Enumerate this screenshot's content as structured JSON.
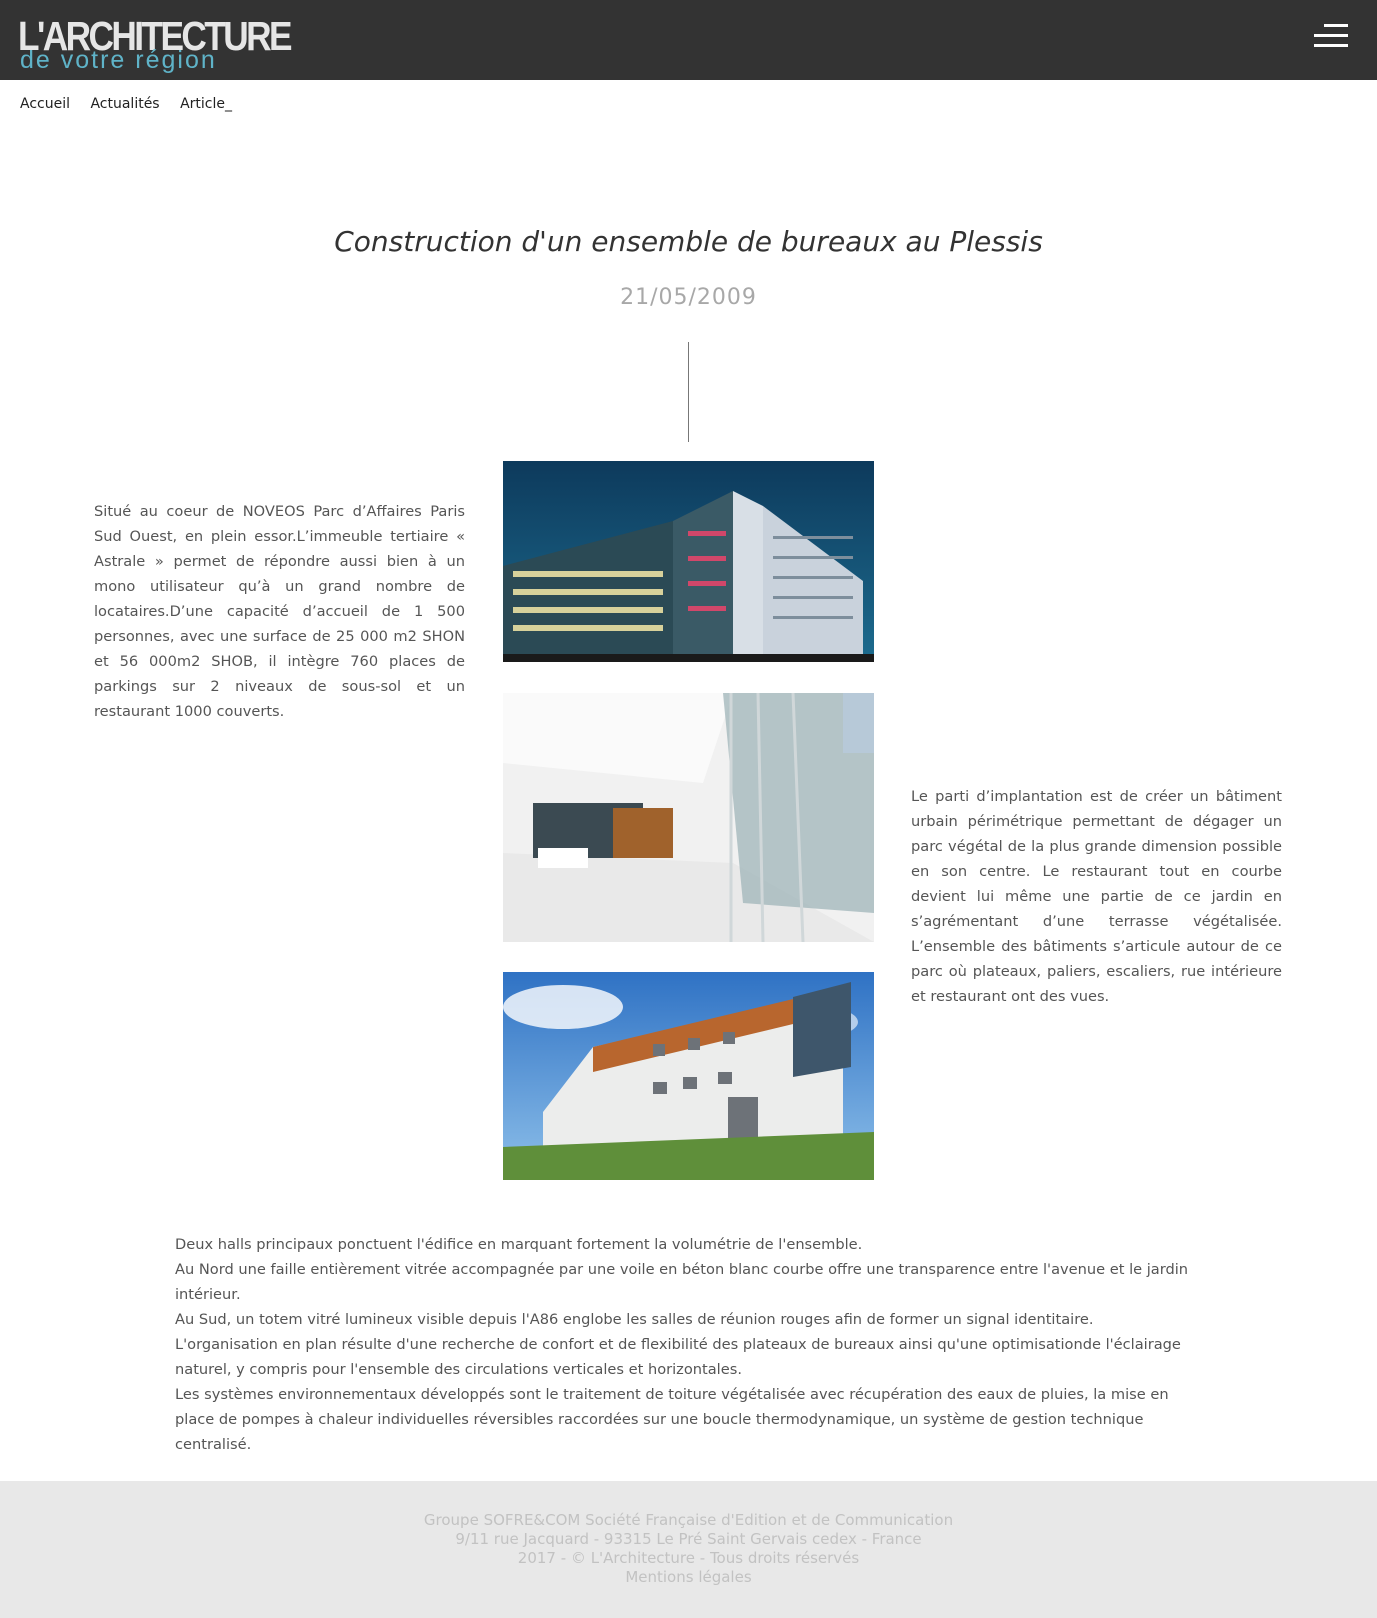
{
  "header": {
    "logo_main": "L'ARCHITECTURE",
    "logo_sub": "de votre région",
    "menu_icon": "hamburger-icon"
  },
  "breadcrumb": [
    "Accueil",
    "Actualités",
    "Article_"
  ],
  "article": {
    "title": "Construction d'un ensemble de bureaux au Plessis",
    "date": "21/05/2009",
    "left_text": "Situé au coeur de NOVEOS Parc d’Affaires Paris Sud Ouest, en plein essor.L’immeuble tertiaire « Astrale » permet de répondre aussi bien à un mono utilisateur qu’à un grand nombre de locataires.D’une capacité d’accueil de 1 500 personnes, avec une surface de 25 000 m2 SHON et 56 000m2 SHOB, il intègre 760 places de parkings sur 2 niveaux de sous-sol et un restaurant 1000 couverts.",
    "right_text": "Le parti d’implantation est de créer un bâtiment urbain périmétrique permettant de dégager un parc végétal de la plus grande dimension possible en son centre. Le restaurant tout en courbe devient lui même une partie de ce jardin en s’agrémentant d’une terrasse végétalisée. L’ensemble des bâtiments s’articule autour de ce parc où plateaux, paliers, escaliers, rue intérieure et restaurant ont des vues.",
    "paragraphs": [
      "Deux halls principaux ponctuent l'édifice en marquant fortement la volumétrie de l'ensemble.",
      "Au Nord une faille entièrement vitrée accompagnée par une voile en béton blanc courbe offre une transparence entre l'avenue et le jardin intérieur.",
      "Au Sud, un totem vitré lumineux visible depuis l'A86 englobe les salles de réunion rouges afin de former un signal identitaire.",
      "L'organisation en plan résulte d'une recherche de confort et de flexibilité des plateaux de bureaux ainsi qu'une optimisationde l'éclairage naturel, y compris pour l'ensemble des circulations verticales et horizontales.",
      "Les systèmes environnementaux développés sont le traitement de toiture végétalisée avec récupération des eaux de pluies, la mise en place de pompes à chaleur individuelles réversibles raccordées sur une boucle thermodynamique, un système de gestion technique centralisé."
    ]
  },
  "footer": {
    "line1": "Groupe SOFRE&COM Société Française d'Edition et de Communication",
    "line2": "9/11 rue Jacquard - 93315 Le Pré Saint Gervais cedex - France",
    "line3": "2017 - © L'Architecture - Tous droits réservés",
    "legal_link": "Mentions légales"
  },
  "colors": {
    "header_bg": "#333333",
    "logo_accent": "#5fb3c8",
    "footer_bg": "#e8e8e8",
    "footer_text": "#c2c2c2",
    "date": "#a8a8a8"
  }
}
